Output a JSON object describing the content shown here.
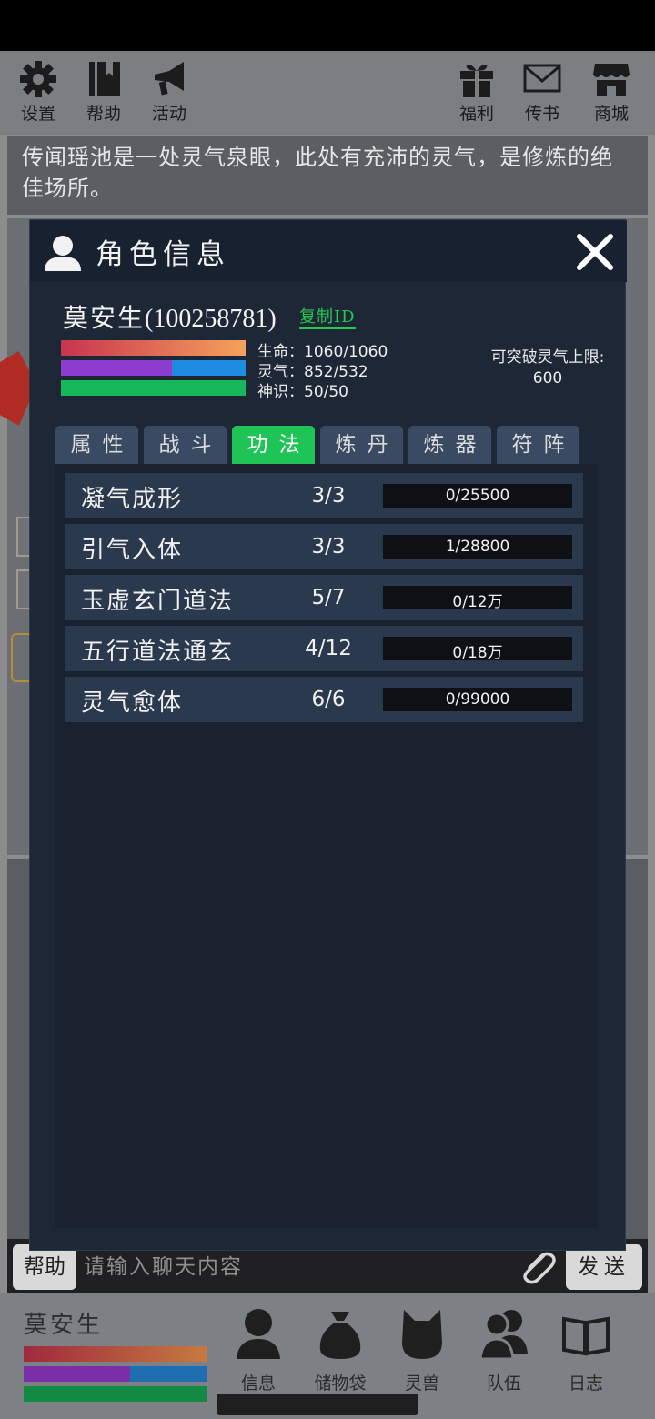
{
  "topbar": {
    "left": [
      {
        "label": "设置",
        "icon": "gear-icon"
      },
      {
        "label": "帮助",
        "icon": "book-icon"
      },
      {
        "label": "活动",
        "icon": "megaphone-icon"
      }
    ],
    "right": [
      {
        "label": "福利",
        "icon": "gift-icon"
      },
      {
        "label": "传书",
        "icon": "mail-icon"
      },
      {
        "label": "商城",
        "icon": "shop-icon"
      }
    ]
  },
  "story": {
    "text": "传闻瑶池是一处灵气泉眼，此处有充沛的灵气，是修炼的绝佳场所。"
  },
  "modal": {
    "title": "角色信息",
    "character": {
      "name": "莫安生",
      "id": "(100258781)",
      "copy_id_label": "复制ID"
    },
    "stats": [
      {
        "label": "生命：1060/1060",
        "fill": 1.0,
        "colors": [
          "#c8344f",
          "#f5a25c"
        ]
      },
      {
        "label": "灵气：852/532",
        "fill": 0.6,
        "colors": [
          "#8e3ccf",
          "#1e8ce0"
        ]
      },
      {
        "label": "神识：50/50",
        "fill": 1.0,
        "colors": [
          "#17b85a",
          "#17b85a"
        ]
      }
    ],
    "breakthrough": {
      "label": "可突破灵气上限:",
      "value": "600"
    },
    "tabs": [
      {
        "label": "属性",
        "active": false
      },
      {
        "label": "战斗",
        "active": false
      },
      {
        "label": "功法",
        "active": true
      },
      {
        "label": "炼丹",
        "active": false
      },
      {
        "label": "炼器",
        "active": false
      },
      {
        "label": "符阵",
        "active": false
      }
    ],
    "skills": [
      {
        "name": "凝气成形",
        "level": "3/3",
        "progress": "0/25500",
        "fill": 0
      },
      {
        "name": "引气入体",
        "level": "3/3",
        "progress": "1/28800",
        "fill": 0
      },
      {
        "name": "玉虚玄门道法",
        "level": "5/7",
        "progress": "0/12万",
        "fill": 0
      },
      {
        "name": "五行道法通玄",
        "level": "4/12",
        "progress": "0/18万",
        "fill": 0
      },
      {
        "name": "灵气愈体",
        "level": "6/6",
        "progress": "0/99000",
        "fill": 0
      }
    ]
  },
  "chatbar": {
    "help_label": "帮助",
    "placeholder": "请输入聊天内容",
    "send_label": "发送"
  },
  "bottombar": {
    "player_name": "莫安生",
    "nav": [
      {
        "label": "信息",
        "icon": "person-icon"
      },
      {
        "label": "储物袋",
        "icon": "bag-icon"
      },
      {
        "label": "灵兽",
        "icon": "cat-icon"
      },
      {
        "label": "队伍",
        "icon": "team-icon"
      },
      {
        "label": "日志",
        "icon": "journal-icon"
      }
    ]
  },
  "colors": {
    "active_tab": "#1ec456",
    "copy_id": "#25c94e",
    "tab": "#3a4a62",
    "modal_bg": "#1e2736"
  }
}
